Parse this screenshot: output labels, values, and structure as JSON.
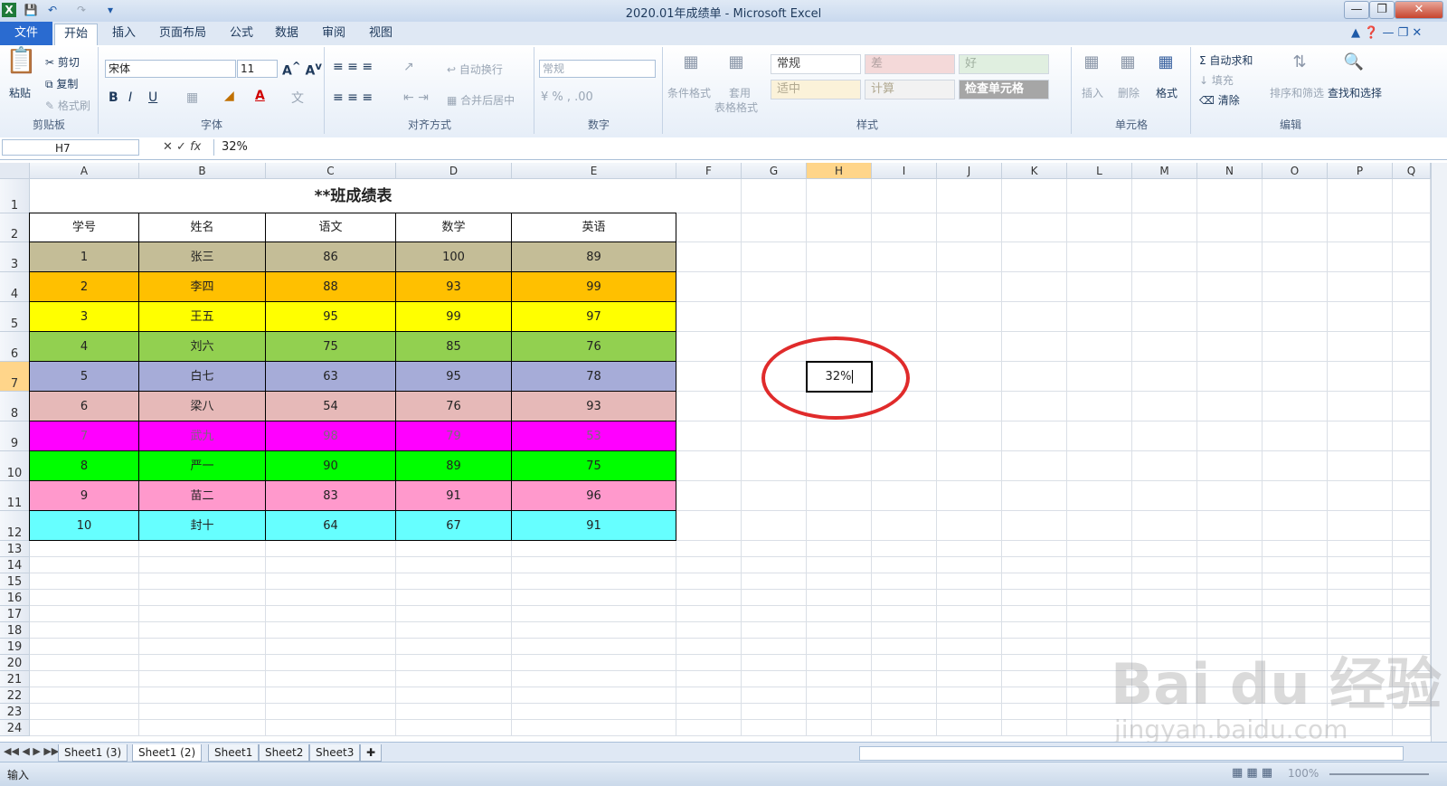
{
  "window": {
    "title": "2020.01年成绩单 - Microsoft Excel",
    "app_icon": "X"
  },
  "ribbon_tabs": [
    "文件",
    "开始",
    "插入",
    "页面布局",
    "公式",
    "数据",
    "审阅",
    "视图"
  ],
  "ribbon": {
    "clipboard": {
      "paste": "粘贴",
      "cut": "剪切",
      "copy": "复制",
      "format_painter": "格式刷",
      "label": "剪贴板"
    },
    "font": {
      "name": "宋体",
      "size": "11",
      "label": "字体"
    },
    "alignment": {
      "wrap": "自动换行",
      "merge": "合并后居中",
      "label": "对齐方式"
    },
    "number": {
      "format": "常规",
      "label": "数字"
    },
    "styles": {
      "cond_format": "条件格式",
      "table_format_1": "套用",
      "table_format_2": "表格格式",
      "cells": [
        "常规",
        "差",
        "好",
        "适中",
        "计算",
        "检查单元格"
      ],
      "label": "样式"
    },
    "cells_group": {
      "insert": "插入",
      "delete": "删除",
      "format": "格式",
      "label": "单元格"
    },
    "editing": {
      "autosum": "自动求和",
      "fill": "填充",
      "clear": "清除",
      "sort": "排序和筛选",
      "find": "查找和选择",
      "label": "编辑"
    }
  },
  "formula_bar": {
    "name_box": "H7",
    "fx": "fx",
    "value": "32%"
  },
  "columns": [
    "A",
    "B",
    "C",
    "D",
    "E",
    "F",
    "G",
    "H",
    "I",
    "J",
    "K",
    "L",
    "M",
    "N",
    "O",
    "P",
    "Q"
  ],
  "rows": [
    "1",
    "2",
    "3",
    "4",
    "5",
    "6",
    "7",
    "8",
    "9",
    "10",
    "11",
    "12",
    "13",
    "14",
    "15",
    "16",
    "17",
    "18",
    "19",
    "20",
    "21",
    "22",
    "23",
    "24"
  ],
  "table": {
    "title": "**班成绩表",
    "headers": [
      "学号",
      "姓名",
      "语文",
      "数学",
      "英语"
    ],
    "rows": [
      {
        "id": "1",
        "name": "张三",
        "chinese": "86",
        "math": "100",
        "english": "89",
        "color": "#c4bd97"
      },
      {
        "id": "2",
        "name": "李四",
        "chinese": "88",
        "math": "93",
        "english": "99",
        "color": "#ffc000"
      },
      {
        "id": "3",
        "name": "王五",
        "chinese": "95",
        "math": "99",
        "english": "97",
        "color": "#ffff00"
      },
      {
        "id": "4",
        "name": "刘六",
        "chinese": "75",
        "math": "85",
        "english": "76",
        "color": "#92d050"
      },
      {
        "id": "5",
        "name": "白七",
        "chinese": "63",
        "math": "95",
        "english": "78",
        "color": "#a6acd8"
      },
      {
        "id": "6",
        "name": "梁八",
        "chinese": "54",
        "math": "76",
        "english": "93",
        "color": "#e6b9b8"
      },
      {
        "id": "7",
        "name": "武九",
        "chinese": "98",
        "math": "79",
        "english": "53",
        "color": "#ff00ff"
      },
      {
        "id": "8",
        "name": "严一",
        "chinese": "90",
        "math": "89",
        "english": "75",
        "color": "#00ff00"
      },
      {
        "id": "9",
        "name": "苗二",
        "chinese": "83",
        "math": "91",
        "english": "96",
        "color": "#ff99cc"
      },
      {
        "id": "10",
        "name": "封十",
        "chinese": "64",
        "math": "67",
        "english": "91",
        "color": "#66ffff"
      }
    ]
  },
  "active_cell": {
    "ref": "H7",
    "value": "32%"
  },
  "sheets": [
    "Sheet1 (3)",
    "Sheet1 (2)",
    "Sheet1",
    "Sheet2",
    "Sheet3"
  ],
  "active_sheet": 1,
  "status": {
    "mode": "输入",
    "zoom": "100%"
  },
  "watermark": {
    "brand": "Bai du 经验",
    "url": "jingyan.baidu.com"
  }
}
